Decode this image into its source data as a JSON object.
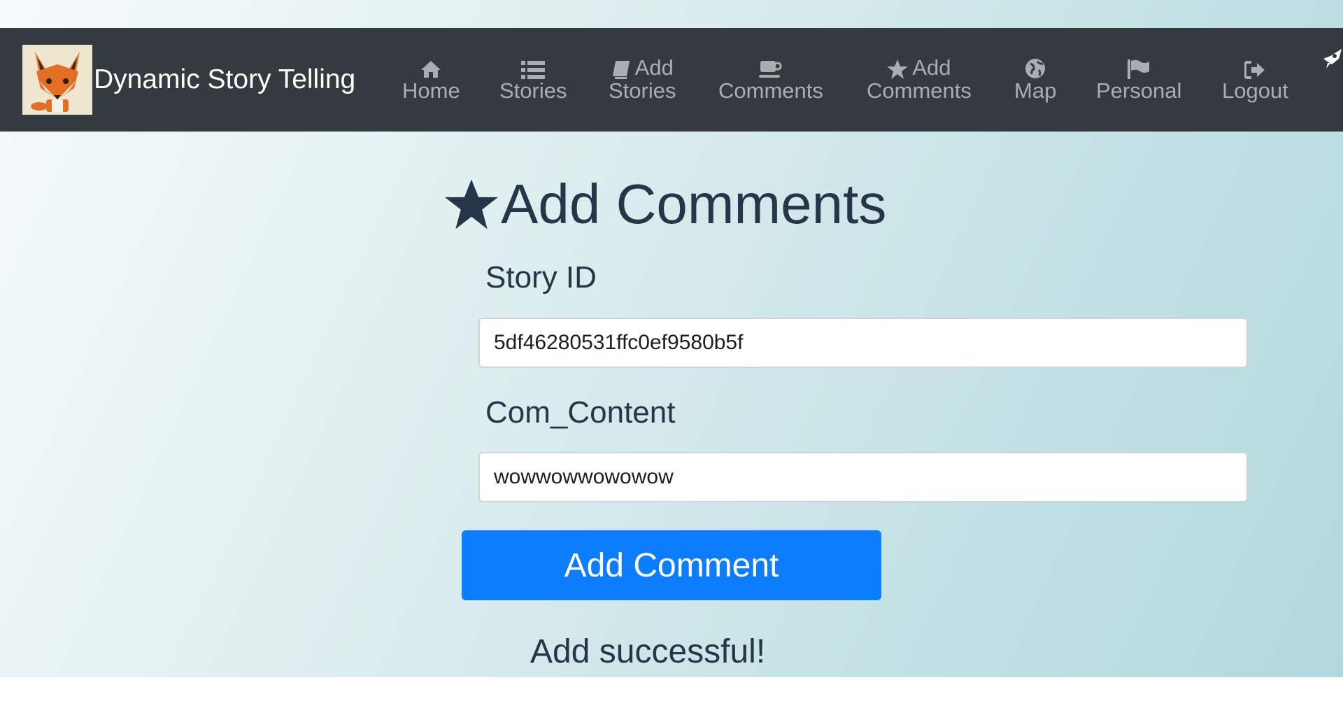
{
  "brand": {
    "title": "Dynamic Story Telling"
  },
  "nav": {
    "home": {
      "label": "Home",
      "icon": "home-icon"
    },
    "stories": {
      "label": "Stories",
      "icon": "list-icon"
    },
    "add_stories": {
      "line1": "Add",
      "line2": "Stories",
      "icon": "book-icon"
    },
    "comments": {
      "label": "Comments",
      "icon": "coffee-icon"
    },
    "add_comments": {
      "line1": "Add",
      "line2": "Comments",
      "icon": "star-icon"
    },
    "map": {
      "label": "Map",
      "icon": "globe-icon"
    },
    "personal": {
      "label": "Personal",
      "icon": "flag-icon"
    },
    "logout": {
      "label": "Logout",
      "icon": "logout-icon"
    }
  },
  "page": {
    "title": "Add Comments",
    "title_icon": "star-icon"
  },
  "form": {
    "story_id_label": "Story ID",
    "story_id_value": "5df46280531ffc0ef9580b5f",
    "content_label": "Com_Content",
    "content_value": "wowwowwowowow",
    "submit_label": "Add Comment"
  },
  "status": {
    "message": "Add successful!"
  },
  "colors": {
    "navbar": "#343a40",
    "nav_text": "#a9aeb3",
    "button": "#0b7dfd",
    "heading": "#263548"
  }
}
